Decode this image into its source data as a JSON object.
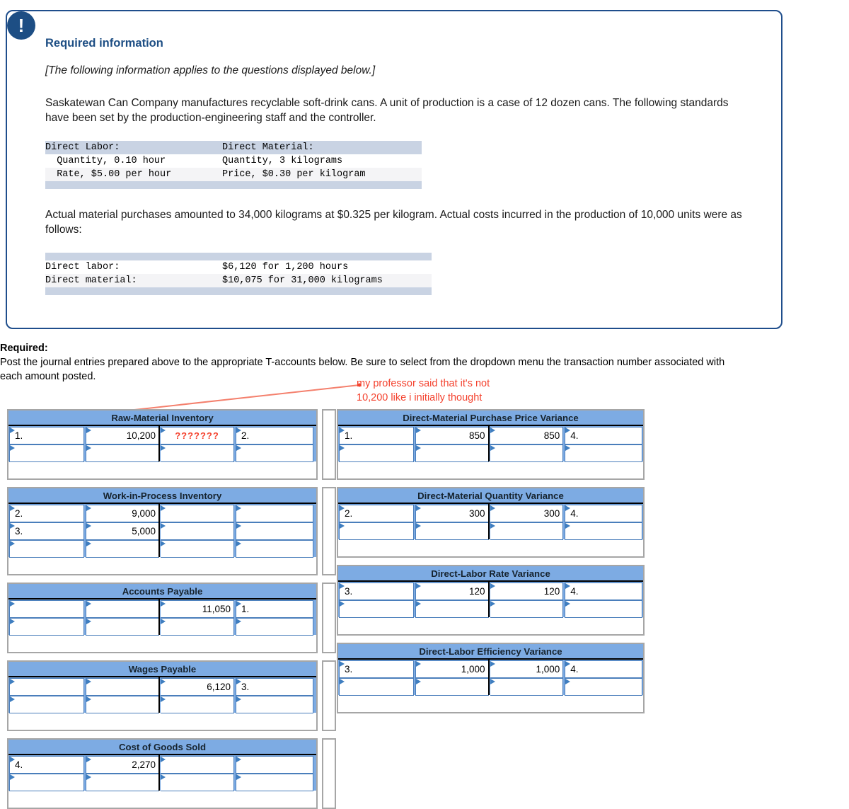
{
  "info_box": {
    "icon": "exclamation-icon",
    "title": "Required information",
    "italic_note": "[The following information applies to the questions displayed below.]",
    "paragraph_1": "Saskatewan Can Company manufactures recyclable soft-drink cans. A unit of production is a case of 12 dozen cans. The following standards have been set by the production-engineering staff and the controller.",
    "standards_table": {
      "rows": [
        {
          "left": "Direct Labor:",
          "right": "Direct Material:"
        },
        {
          "left": "  Quantity, 0.10 hour",
          "right": "Quantity, 3 kilograms"
        },
        {
          "left": "  Rate, $5.00 per hour",
          "right": "Price, $0.30 per kilogram"
        }
      ]
    },
    "paragraph_2": "Actual material purchases amounted to 34,000 kilograms at $0.325 per kilogram. Actual costs incurred in the production of 10,000 units were as follows:",
    "actual_table": {
      "rows": [
        {
          "left": "Direct labor:",
          "right": "$6,120 for 1,200 hours"
        },
        {
          "left": "Direct material:",
          "right": "$10,075 for 31,000 kilograms"
        }
      ]
    }
  },
  "required": {
    "heading": "Required:",
    "body": "Post the journal entries prepared above to the appropriate T-accounts below. Be sure to select from the dropdown menu the transaction number associated with each amount posted."
  },
  "annotation": {
    "line1": "my professor said that it's not",
    "line2": "10,200 like i initially thought",
    "color": "#f4422e"
  },
  "colors": {
    "header_blue": "#7dabe3",
    "box_border_blue": "#1f4e8c",
    "title_blue": "#1d4e84",
    "annotation_red": "#f4422e",
    "cell_border_blue": "#4a7ebb",
    "table_border_gray": "#a6a6a6"
  },
  "t_accounts": {
    "left": [
      {
        "title": "Raw-Material Inventory",
        "rows": [
          {
            "c1": "1.",
            "c2": "10,200",
            "c3": "???????",
            "c4": "2.",
            "c3_style": "qmark"
          },
          {
            "c1": "",
            "c2": "",
            "c3": "",
            "c4": ""
          }
        ]
      },
      {
        "title": "Work-in-Process Inventory",
        "rows": [
          {
            "c1": "2.",
            "c2": "9,000",
            "c3": "",
            "c4": ""
          },
          {
            "c1": "3.",
            "c2": "5,000",
            "c3": "",
            "c4": ""
          },
          {
            "c1": "",
            "c2": "",
            "c3": "",
            "c4": ""
          }
        ]
      },
      {
        "title": "Accounts Payable",
        "rows": [
          {
            "c1": "",
            "c2": "",
            "c3": "11,050",
            "c4": "1."
          },
          {
            "c1": "",
            "c2": "",
            "c3": "",
            "c4": ""
          }
        ]
      },
      {
        "title": "Wages Payable",
        "rows": [
          {
            "c1": "",
            "c2": "",
            "c3": "6,120",
            "c4": "3."
          },
          {
            "c1": "",
            "c2": "",
            "c3": "",
            "c4": ""
          }
        ]
      },
      {
        "title": "Cost of Goods Sold",
        "rows": [
          {
            "c1": "4.",
            "c2": "2,270",
            "c3": "",
            "c4": ""
          },
          {
            "c1": "",
            "c2": "",
            "c3": "",
            "c4": ""
          }
        ]
      }
    ],
    "right": [
      {
        "title": "Direct-Material Purchase Price Variance",
        "rows": [
          {
            "c1": "1.",
            "c2": "850",
            "c3": "850",
            "c4": "4."
          },
          {
            "c1": "",
            "c2": "",
            "c3": "",
            "c4": ""
          }
        ]
      },
      {
        "title": "Direct-Material Quantity Variance",
        "rows": [
          {
            "c1": "2.",
            "c2": "300",
            "c3": "300",
            "c4": "4."
          },
          {
            "c1": "",
            "c2": "",
            "c3": "",
            "c4": ""
          }
        ]
      },
      {
        "title": "Direct-Labor Rate Variance",
        "rows": [
          {
            "c1": "3.",
            "c2": "120",
            "c3": "120",
            "c4": "4."
          },
          {
            "c1": "",
            "c2": "",
            "c3": "",
            "c4": ""
          }
        ]
      },
      {
        "title": "Direct-Labor Efficiency Variance",
        "rows": [
          {
            "c1": "3.",
            "c2": "1,000",
            "c3": "1,000",
            "c4": "4."
          },
          {
            "c1": "",
            "c2": "",
            "c3": "",
            "c4": ""
          }
        ]
      }
    ]
  }
}
